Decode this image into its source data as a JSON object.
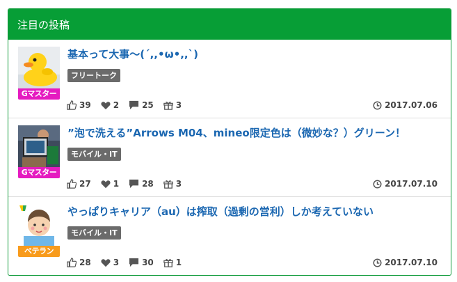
{
  "header": {
    "title": "注目の投稿"
  },
  "posts": [
    {
      "title": "基本って大事〜(´,,•ω•,,`)",
      "category": "フリートーク",
      "badge": "Gマスター",
      "likes": "39",
      "hearts": "2",
      "comments": "25",
      "gifts": "3",
      "date": "2017.07.06"
    },
    {
      "title": "”泡で洗える”Arrows M04、mineo限定色は（微妙な？）グリーン！",
      "category": "モバイル・IT",
      "badge": "Gマスター",
      "likes": "27",
      "hearts": "1",
      "comments": "28",
      "gifts": "3",
      "date": "2017.07.10"
    },
    {
      "title": "やっぱりキャリア（au）は搾取（過剰の営利）しか考えていない",
      "category": "モバイル・IT",
      "badge": "ベテラン",
      "likes": "28",
      "hearts": "3",
      "comments": "30",
      "gifts": "1",
      "date": "2017.07.10"
    }
  ],
  "colors": {
    "header_bg": "#079e36",
    "title": "#1b67b1",
    "badge_gmaster": "#e51bc0",
    "badge_veteran": "#f89b1c"
  },
  "icons": {
    "like": "thumbs-up-icon",
    "heart": "heart-icon",
    "comment": "comment-icon",
    "gift": "gift-icon",
    "date": "clock-icon"
  }
}
